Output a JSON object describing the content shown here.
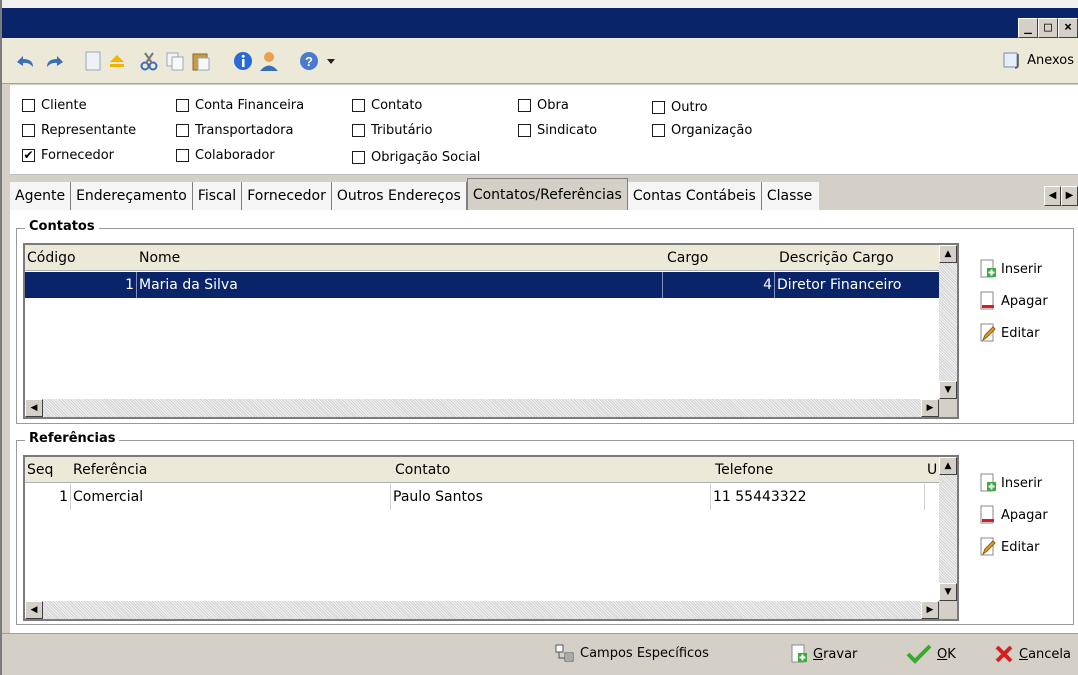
{
  "window_buttons": [
    "_",
    "□",
    "×"
  ],
  "toolbar": {
    "anexos_label": "Anexos"
  },
  "checks": [
    {
      "label": "Cliente",
      "checked": false
    },
    {
      "label": "Representante",
      "checked": false
    },
    {
      "label": "Fornecedor",
      "checked": true
    },
    {
      "label": "Conta Financeira",
      "checked": false
    },
    {
      "label": "Transportadora",
      "checked": false
    },
    {
      "label": "Colaborador",
      "checked": false
    },
    {
      "label": "Contato",
      "checked": false
    },
    {
      "label": "Tributário",
      "checked": false
    },
    {
      "label": "Obrigação Social",
      "checked": false
    },
    {
      "label": "Obra",
      "checked": false
    },
    {
      "label": "Sindicato",
      "checked": false
    },
    {
      "label": "Outro",
      "checked": false
    },
    {
      "label": "Organização",
      "checked": false
    }
  ],
  "tabs": [
    "Agente",
    "Endereçamento",
    "Fiscal",
    "Fornecedor",
    "Outros Endereços",
    "Contatos/Referências",
    "Contas Contábeis",
    "Classe"
  ],
  "contatos": {
    "title": "Contatos",
    "columns": [
      "Código",
      "Nome",
      "Cargo",
      "Descrição Cargo"
    ],
    "rows": [
      {
        "codigo": "1",
        "nome": "Maria da Silva",
        "cargo": "4",
        "descricao": "Diretor Financeiro"
      }
    ]
  },
  "referencias": {
    "title": "Referências",
    "columns": [
      "Seq",
      "Referência",
      "Contato",
      "Telefone",
      "U"
    ],
    "rows": [
      {
        "seq": "1",
        "referencia": "Comercial",
        "contato": "Paulo Santos",
        "telefone": "11 55443322"
      }
    ]
  },
  "side_buttons": {
    "inserir": "Inserir",
    "apagar": "Apagar",
    "editar": "Editar"
  },
  "footer": {
    "campos": "Campos Específicos",
    "gravar_u": "G",
    "gravar_rest": "ravar",
    "ok_u": "O",
    "ok_rest": "K",
    "cancelar_u": "C",
    "cancelar_rest": "ancela"
  }
}
